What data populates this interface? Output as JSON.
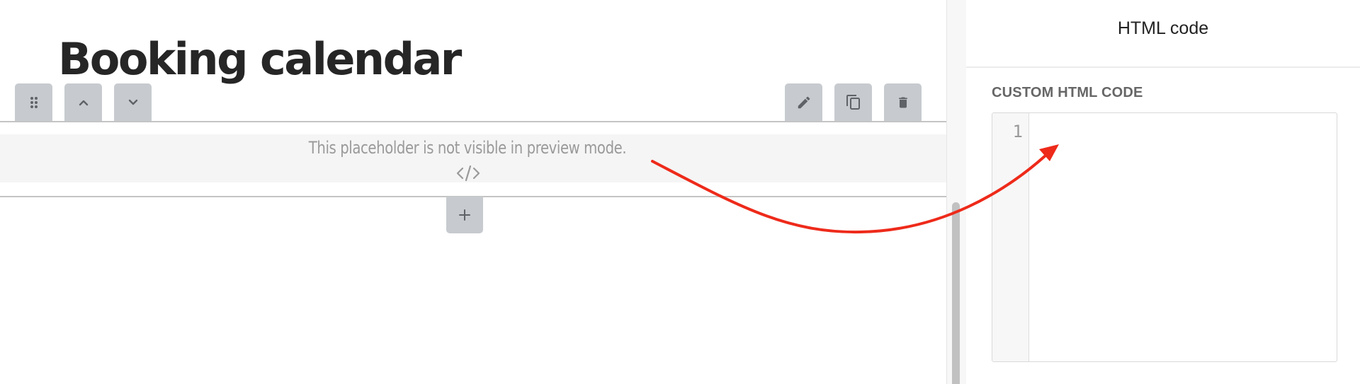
{
  "editor": {
    "page_title": "Booking calendar",
    "placeholder_text": "This placeholder is not visible in preview mode.",
    "toolbar": {
      "left": [
        "drag-handle-icon",
        "chevron-up-icon",
        "chevron-down-icon"
      ],
      "right": [
        "pencil-icon",
        "copy-icon",
        "trash-icon"
      ]
    },
    "add_button_icon": "plus-icon",
    "code_icon": "code-brackets-icon"
  },
  "panel": {
    "title": "HTML code",
    "section_label": "CUSTOM HTML CODE",
    "code_editor": {
      "line_numbers": [
        "1"
      ],
      "value": ""
    }
  },
  "colors": {
    "title_text": "#262626",
    "toolbar_button_bg": "#c7cbcf",
    "toolbar_icon": "#5f6368",
    "placeholder_bg": "#f5f5f5",
    "placeholder_text": "#9a9a9a",
    "annotation_arrow": "#ee2a1a",
    "section_label": "#666666"
  }
}
